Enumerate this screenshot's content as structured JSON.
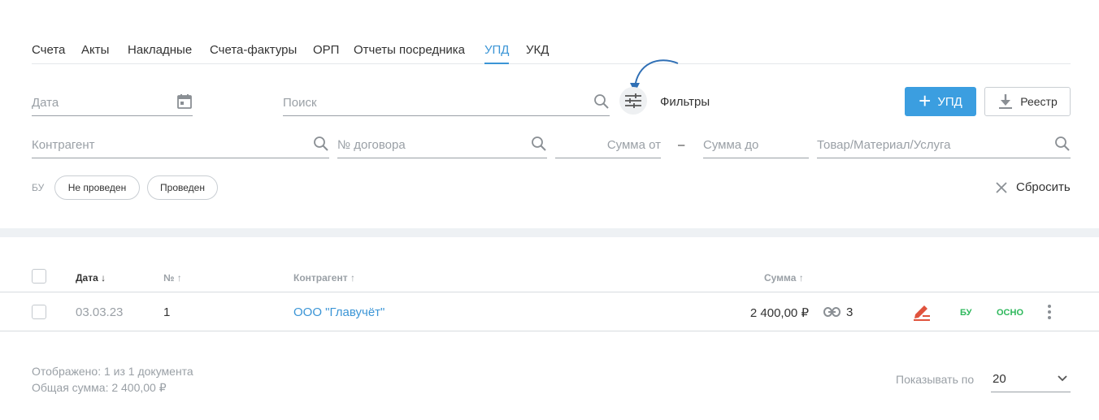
{
  "tabs": [
    {
      "label": "Счета"
    },
    {
      "label": "Акты"
    },
    {
      "label": "Накладные"
    },
    {
      "label": "Счета-фактуры"
    },
    {
      "label": "ОРП"
    },
    {
      "label": "Отчеты посредника"
    },
    {
      "label": "УПД",
      "active": true
    },
    {
      "label": "УКД"
    }
  ],
  "filters": {
    "date_placeholder": "Дата",
    "search_placeholder": "Поиск",
    "filters_label": "Фильтры",
    "counterparty_placeholder": "Контрагент",
    "contract_placeholder": "№ договора",
    "sum_from_placeholder": "Сумма от",
    "sum_dash": "–",
    "sum_to_placeholder": "Сумма до",
    "goods_placeholder": "Товар/Материал/Услуга",
    "chip_caption": "БУ",
    "chips": [
      "Не проведен",
      "Проведен"
    ],
    "reset_label": "Сбросить"
  },
  "actions": {
    "add_upd_label": "УПД",
    "registry_label": "Реестр"
  },
  "table": {
    "headers": {
      "date": "Дата",
      "date_sort": "↓",
      "number": "№",
      "number_sort": "↑",
      "counterparty": "Контрагент",
      "counterparty_sort": "↑",
      "sum": "Сумма",
      "sum_sort": "↑"
    },
    "rows": [
      {
        "date": "03.03.23",
        "number": "1",
        "counterparty": "ООО \"Главучёт\"",
        "sum": "2 400,00 ₽",
        "links_count": "3",
        "badge_bu": "БУ",
        "badge_osno": "ОСНО"
      }
    ]
  },
  "footer": {
    "shown": "Отображено: 1 из 1 документа",
    "total": "Общая сумма: 2 400,00 ₽",
    "page_size_label": "Показывать по",
    "page_size_value": "20"
  },
  "colors": {
    "accent": "#3b95d6",
    "primary_button": "#3b9ee0",
    "status_green": "#2eb85c",
    "sign_icon_red": "#e0533d"
  }
}
